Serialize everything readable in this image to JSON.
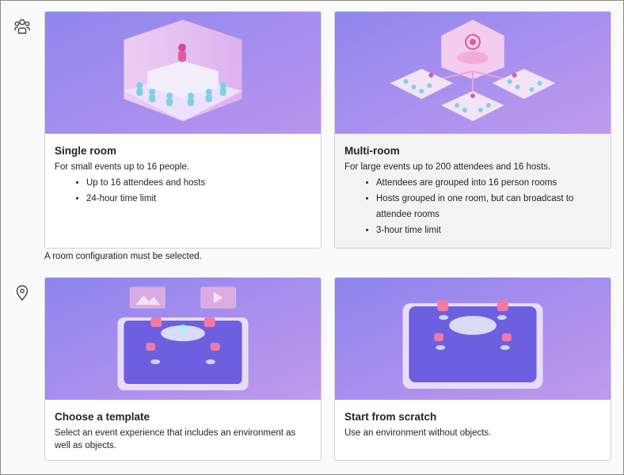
{
  "room_section": {
    "icon": "people-group-icon",
    "cards": [
      {
        "title": "Single room",
        "description": "For small events up to 16 people.",
        "bullets": [
          "Up to 16 attendees and hosts",
          "24-hour time limit"
        ]
      },
      {
        "title": "Multi-room",
        "description": "For large events up to 200 attendees and 16 hosts.",
        "bullets": [
          "Attendees are grouped into 16 person rooms",
          "Hosts grouped in one room, but can broadcast to attendee rooms",
          "3-hour time limit"
        ]
      }
    ],
    "helper_text": "A room configuration must be selected."
  },
  "environment_section": {
    "icon": "location-pin-icon",
    "cards": [
      {
        "title": "Choose a template",
        "description": "Select an event experience that includes an environment as well as objects."
      },
      {
        "title": "Start from scratch",
        "description": "Use an environment without objects."
      }
    ]
  },
  "colors": {
    "image_bg_start": "#8c8ef0",
    "image_bg_end": "#c79ee8",
    "accent_pink": "#e05aa0",
    "figure_teal": "#7fd0e6"
  }
}
